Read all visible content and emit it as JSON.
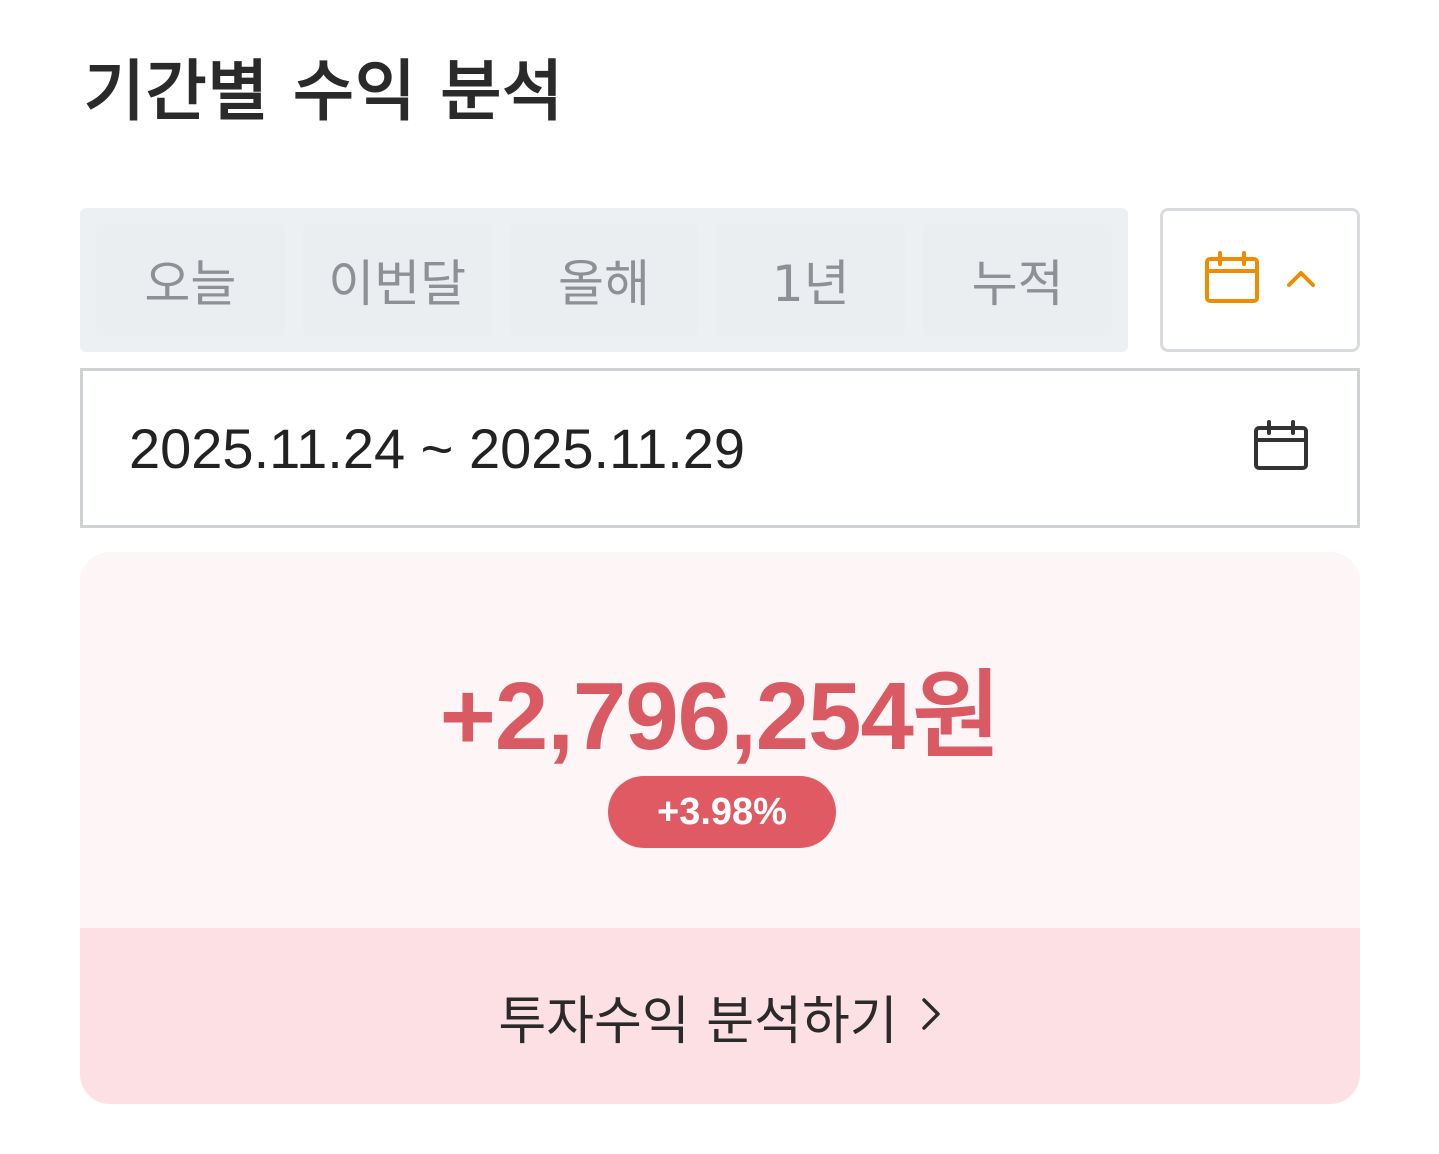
{
  "page": {
    "title": "기간별 수익 분석"
  },
  "period_tabs": [
    {
      "label": "오늘"
    },
    {
      "label": "이번달"
    },
    {
      "label": "올해"
    },
    {
      "label": "1년"
    },
    {
      "label": "누적"
    }
  ],
  "calendar_toggle": {
    "icon": "calendar-icon",
    "chevron": "chevron-up-icon",
    "accent": "#f08c00"
  },
  "date_range": {
    "value": "2025.11.24 ~ 2025.11.29",
    "icon": "calendar-icon"
  },
  "summary": {
    "amount": "+2,796,254원",
    "rate": "+3.98%",
    "accent": "#e05a63"
  },
  "analyze_link": {
    "label": "투자수익 분석하기",
    "icon": "chevron-right-icon"
  }
}
